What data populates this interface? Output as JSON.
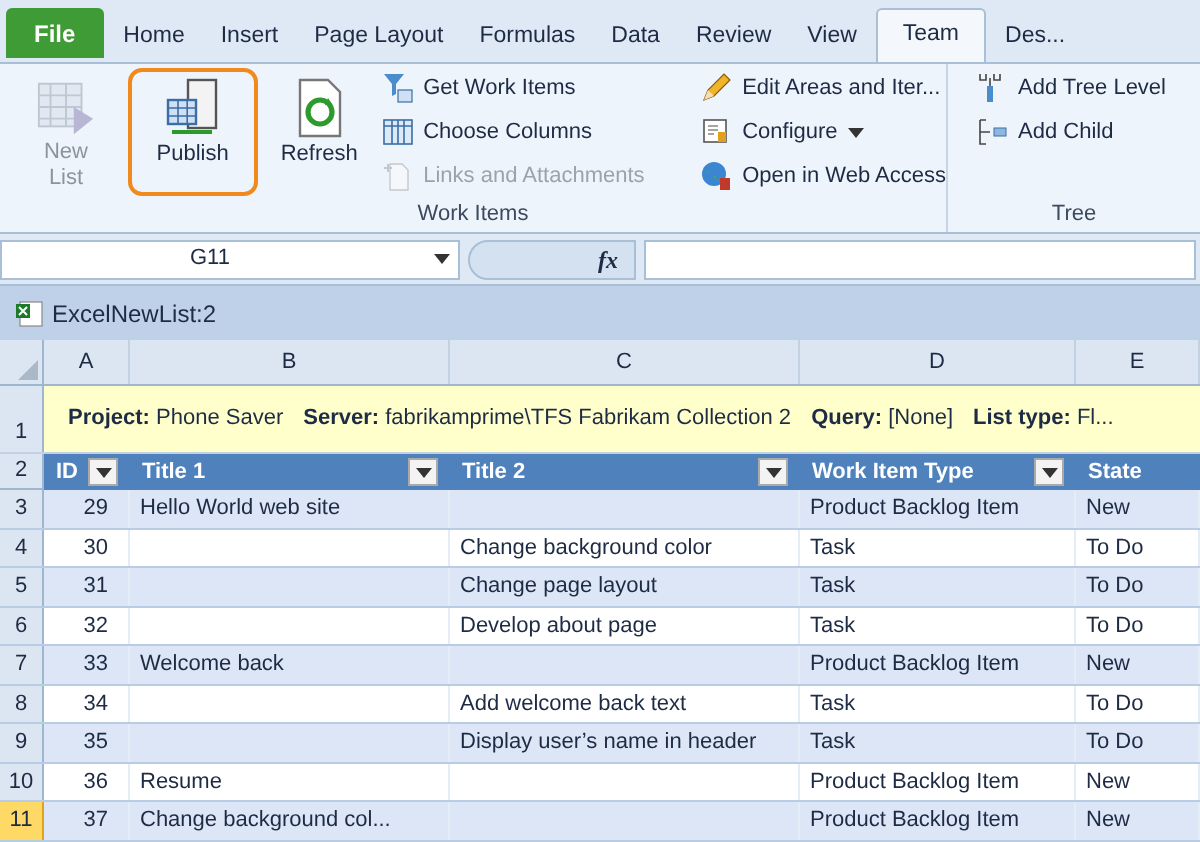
{
  "ribbon_tabs": [
    {
      "label": "File",
      "kind": "file",
      "selected": false
    },
    {
      "label": "Home",
      "kind": "tab",
      "selected": false
    },
    {
      "label": "Insert",
      "kind": "tab",
      "selected": false
    },
    {
      "label": "Page Layout",
      "kind": "tab",
      "selected": false
    },
    {
      "label": "Formulas",
      "kind": "tab",
      "selected": false
    },
    {
      "label": "Data",
      "kind": "tab",
      "selected": false
    },
    {
      "label": "Review",
      "kind": "tab",
      "selected": false
    },
    {
      "label": "View",
      "kind": "tab",
      "selected": false
    },
    {
      "label": "Team",
      "kind": "tab",
      "selected": true
    },
    {
      "label": "Des...",
      "kind": "tab",
      "selected": false
    }
  ],
  "ribbon_groups": [
    {
      "label": "Work Items",
      "large_buttons": [
        {
          "label": "New List",
          "kind": "new-list",
          "disabled": true,
          "highlighted": false
        },
        {
          "label": "Publish",
          "kind": "publish",
          "disabled": false,
          "highlighted": true
        },
        {
          "label": "Refresh",
          "kind": "refresh",
          "disabled": false,
          "highlighted": false
        }
      ],
      "columns": [
        [
          {
            "label": "Get Work Items",
            "kind": "get",
            "disabled": false,
            "dropdown": false
          },
          {
            "label": "Choose Columns",
            "kind": "columns",
            "disabled": false,
            "dropdown": false
          },
          {
            "label": "Links and Attachments",
            "kind": "links",
            "disabled": true,
            "dropdown": false
          }
        ],
        [
          {
            "label": "Edit Areas and Iter...",
            "kind": "pencil",
            "disabled": false,
            "dropdown": false
          },
          {
            "label": "Configure",
            "kind": "configure",
            "disabled": false,
            "dropdown": true
          },
          {
            "label": "Open in Web Access",
            "kind": "globe",
            "disabled": false,
            "dropdown": false
          }
        ]
      ]
    },
    {
      "label": "Tree",
      "columns": [
        [
          {
            "label": "Add Tree Level",
            "kind": "tree-level",
            "disabled": false,
            "dropdown": false
          },
          {
            "label": "Add Child",
            "kind": "child",
            "disabled": false,
            "dropdown": false
          }
        ]
      ]
    }
  ],
  "formula_bar": {
    "name_box": "G11",
    "fx": "fx"
  },
  "list_bar": {
    "title": "ExcelNewList:2"
  },
  "sheet": {
    "column_letters": [
      "A",
      "B",
      "C",
      "D",
      "E"
    ],
    "info_row": {
      "row_number": "1",
      "parts": [
        "**Project:** Phone Saver",
        "**Server:** fabrikamprime\\TFS Fabrikam Collection 2",
        "**Query:** [None]",
        "**List type:** Fl..."
      ]
    },
    "header_row": {
      "row_number": "2",
      "columns": [
        "ID",
        "Title 1",
        "Title 2",
        "Work Item Type",
        "State"
      ]
    },
    "rows": [
      {
        "row_number": "3",
        "selected": false,
        "cells": [
          "29",
          "Hello World web site",
          "",
          "Product Backlog Item",
          "New"
        ]
      },
      {
        "row_number": "4",
        "selected": false,
        "cells": [
          "30",
          "",
          "Change background color",
          "Task",
          "To Do"
        ]
      },
      {
        "row_number": "5",
        "selected": false,
        "cells": [
          "31",
          "",
          "Change page layout",
          "Task",
          "To Do"
        ]
      },
      {
        "row_number": "6",
        "selected": false,
        "cells": [
          "32",
          "",
          "Develop about page",
          "Task",
          "To Do"
        ]
      },
      {
        "row_number": "7",
        "selected": false,
        "cells": [
          "33",
          "Welcome back",
          "",
          "Product Backlog Item",
          "New"
        ]
      },
      {
        "row_number": "8",
        "selected": false,
        "cells": [
          "34",
          "",
          "Add welcome back text",
          "Task",
          "To Do"
        ]
      },
      {
        "row_number": "9",
        "selected": false,
        "cells": [
          "35",
          "",
          "Display user’s name in header",
          "Task",
          "To Do"
        ]
      },
      {
        "row_number": "10",
        "selected": false,
        "cells": [
          "36",
          "Resume",
          "",
          "Product Backlog Item",
          "New"
        ]
      },
      {
        "row_number": "11",
        "selected": true,
        "cells": [
          "37",
          "Change background col...",
          "",
          "Product Backlog Item",
          "New"
        ]
      }
    ]
  }
}
